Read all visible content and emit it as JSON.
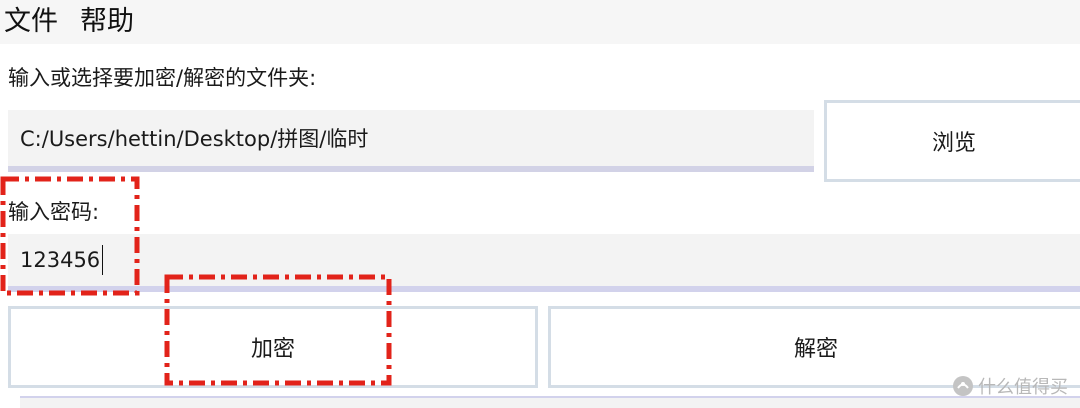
{
  "menu": {
    "items": [
      {
        "label": "文件"
      },
      {
        "label": "帮助"
      }
    ]
  },
  "folder": {
    "label": "输入或选择要加密/解密的文件夹:",
    "path_value": "C:/Users/hettin/Desktop/拼图/临时",
    "browse_label": "浏览"
  },
  "password": {
    "label": "输入密码:",
    "value": "123456"
  },
  "actions": {
    "encrypt_label": "加密",
    "decrypt_label": "解密"
  },
  "annotations": {
    "color": "#e2231a"
  },
  "watermark": {
    "text": "什么值得买"
  }
}
